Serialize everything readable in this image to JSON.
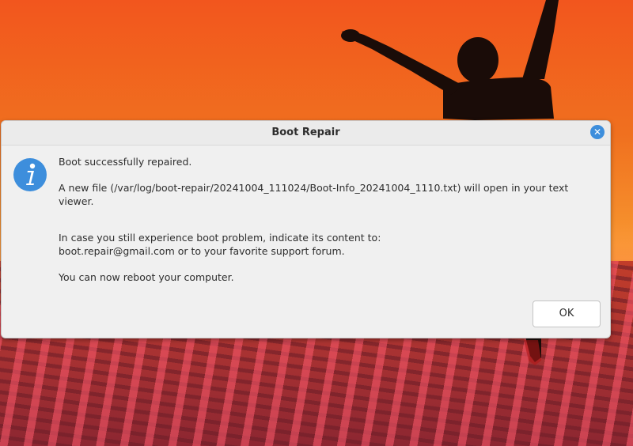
{
  "dialog": {
    "title": "Boot Repair",
    "close_icon": "close-icon",
    "info_icon": "info-icon",
    "messages": {
      "success": "Boot successfully repaired.",
      "file_notice": "A new file (/var/log/boot-repair/20241004_111024/Boot-Info_20241004_1110.txt) will open in your text viewer.",
      "problem_line1": "In case you still experience boot problem, indicate its content to:",
      "problem_line2": "boot.repair@gmail.com or to your favorite support forum.",
      "reboot": "You can now reboot your computer."
    },
    "ok_label": "OK"
  },
  "colors": {
    "accent": "#3d8edc",
    "dialog_bg": "#f0f0f0",
    "wallpaper_orange": "#f2561e"
  }
}
